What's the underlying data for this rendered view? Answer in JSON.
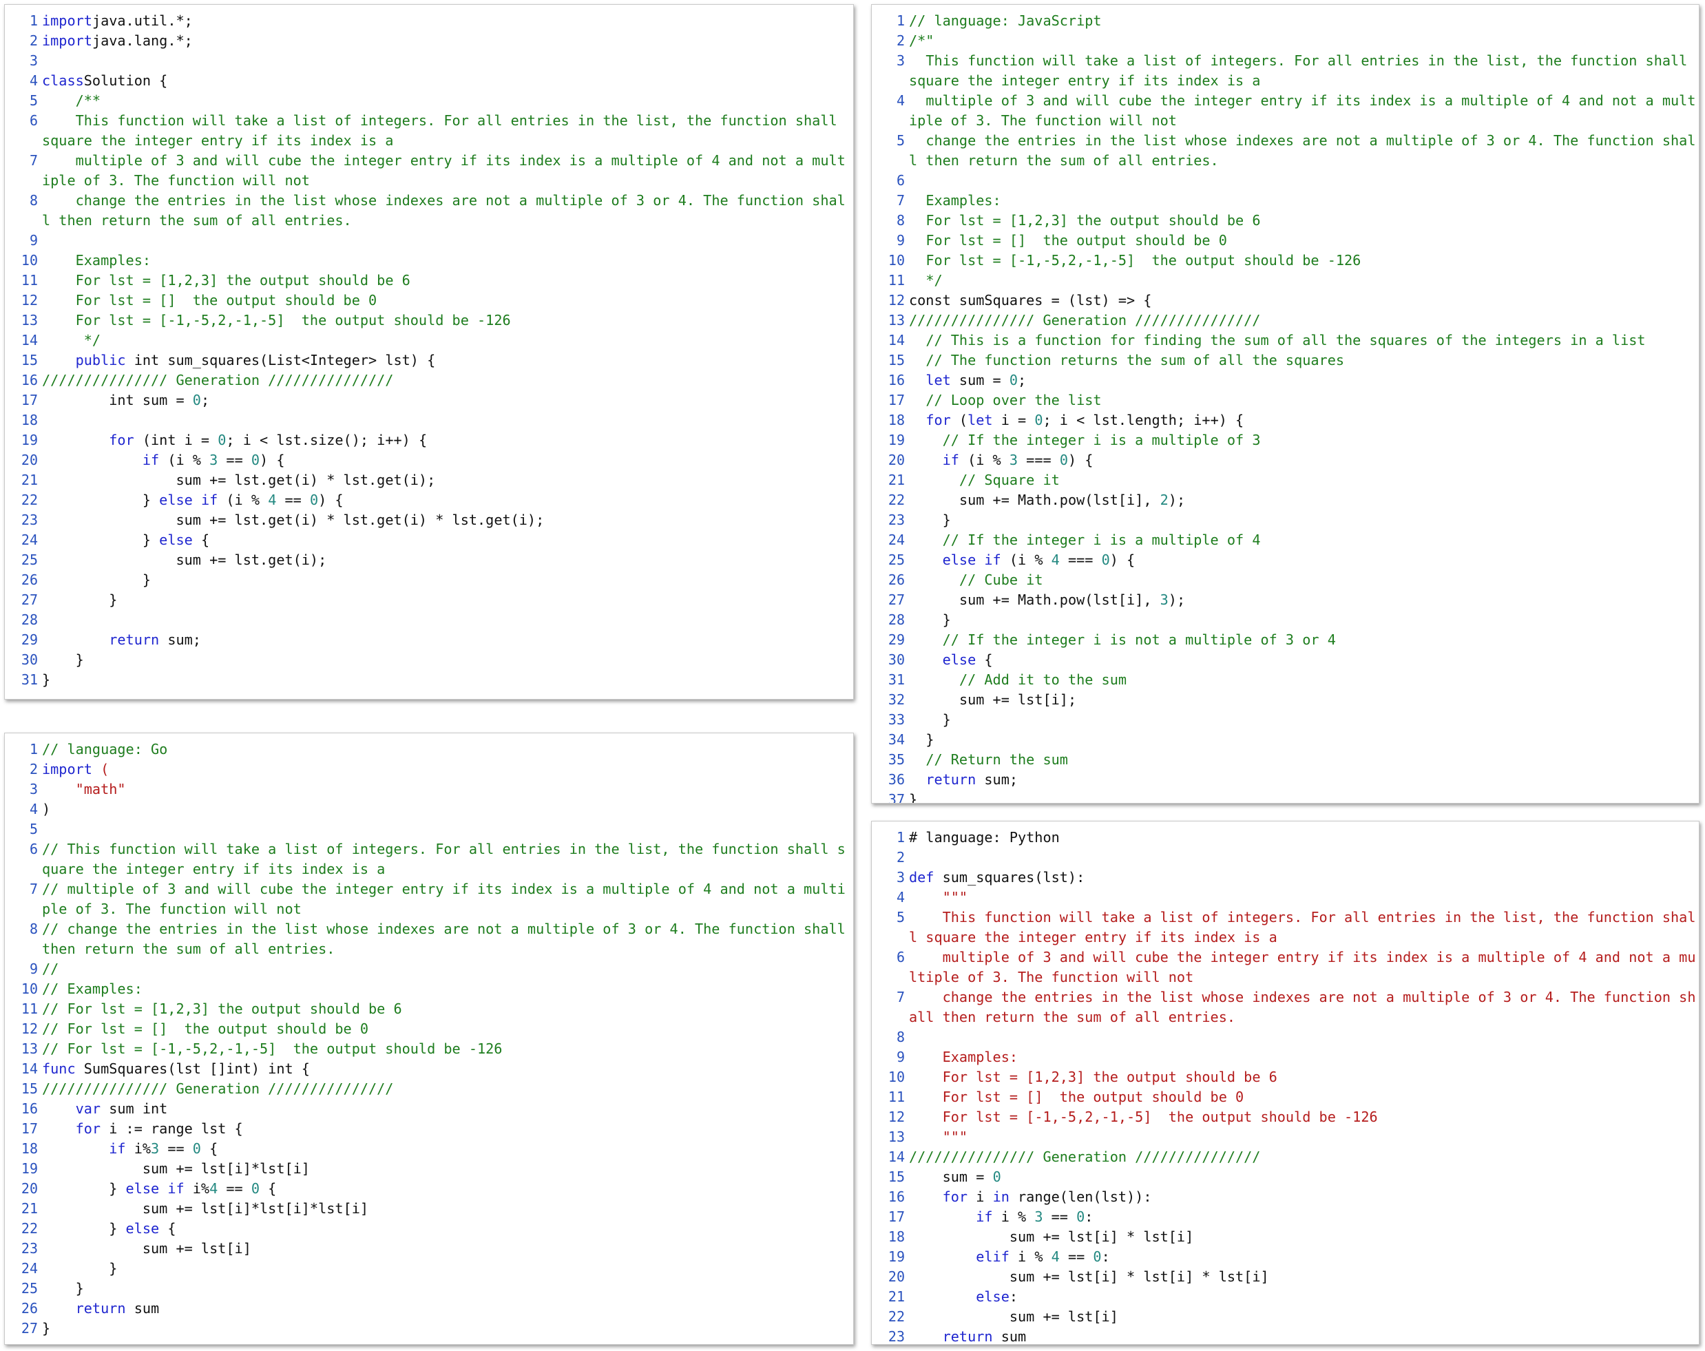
{
  "colors": {
    "keyword": "#1f26cf",
    "comment": "#1e7d1e",
    "number": "#228880",
    "string": "#b51d1d",
    "line_number": "#2a52be",
    "text": "#111111"
  },
  "panels": [
    {
      "id": "java",
      "lines": [
        [
          [
            "kw",
            "import"
          ],
          [
            "",
            "java.util.*;"
          ]
        ],
        [
          [
            "kw",
            "import"
          ],
          [
            "",
            "java.lang.*;"
          ]
        ],
        [],
        [
          [
            "kw",
            "class"
          ],
          [
            "",
            "Solution {"
          ]
        ],
        [
          [
            "com",
            "    /**"
          ]
        ],
        [
          [
            "com",
            "    This function will take a list of integers. For all entries in the list, the function shall square the integer entry if its index is a"
          ]
        ],
        [
          [
            "com",
            "    multiple of 3 and will cube the integer entry if its index is a multiple of 4 and not a multiple of 3. The function will not"
          ]
        ],
        [
          [
            "com",
            "    change the entries in the list whose indexes are not a multiple of 3 or 4. The function shall then return the sum of all entries."
          ]
        ],
        [],
        [
          [
            "com",
            "    Examples:"
          ]
        ],
        [
          [
            "com",
            "    For lst = [1,2,3] the output should be 6"
          ]
        ],
        [
          [
            "com",
            "    For lst = []  the output should be 0"
          ]
        ],
        [
          [
            "com",
            "    For lst = [-1,-5,2,-1,-5]  the output should be -126"
          ]
        ],
        [
          [
            "com",
            "     */"
          ]
        ],
        [
          [
            "",
            "    "
          ],
          [
            "kw",
            "public"
          ],
          [
            "",
            " int sum_squares(List<Integer> lst) {"
          ]
        ],
        [
          [
            "com",
            "/////////////// Generation ///////////////"
          ]
        ],
        [
          [
            "",
            "        int sum = "
          ],
          [
            "num",
            "0"
          ],
          [
            "",
            ";"
          ]
        ],
        [],
        [
          [
            "",
            "        "
          ],
          [
            "kw",
            "for"
          ],
          [
            "",
            " (int i = "
          ],
          [
            "num",
            "0"
          ],
          [
            "",
            "; i < lst.size(); i++) {"
          ]
        ],
        [
          [
            "",
            "            "
          ],
          [
            "kw",
            "if"
          ],
          [
            "",
            " (i % "
          ],
          [
            "num",
            "3"
          ],
          [
            "",
            " == "
          ],
          [
            "num",
            "0"
          ],
          [
            "",
            ") {"
          ]
        ],
        [
          [
            "",
            "                sum += lst.get(i) * lst.get(i);"
          ]
        ],
        [
          [
            "",
            "            } "
          ],
          [
            "kw",
            "else if"
          ],
          [
            "",
            " (i % "
          ],
          [
            "num",
            "4"
          ],
          [
            "",
            " == "
          ],
          [
            "num",
            "0"
          ],
          [
            "",
            ") {"
          ]
        ],
        [
          [
            "",
            "                sum += lst.get(i) * lst.get(i) * lst.get(i);"
          ]
        ],
        [
          [
            "",
            "            } "
          ],
          [
            "kw",
            "else"
          ],
          [
            "",
            " {"
          ]
        ],
        [
          [
            "",
            "                sum += lst.get(i);"
          ]
        ],
        [
          [
            "",
            "            }"
          ]
        ],
        [
          [
            "",
            "        }"
          ]
        ],
        [],
        [
          [
            "",
            "        "
          ],
          [
            "kw",
            "return"
          ],
          [
            "",
            " sum;"
          ]
        ],
        [
          [
            "",
            "    }"
          ]
        ],
        [
          [
            "",
            "}"
          ]
        ]
      ]
    },
    {
      "id": "js",
      "lines": [
        [
          [
            "com",
            "// language: JavaScript"
          ]
        ],
        [
          [
            "com",
            "/*\""
          ]
        ],
        [
          [
            "com",
            "  This function will take a list of integers. For all entries in the list, the function shall square the integer entry if its index is a"
          ]
        ],
        [
          [
            "com",
            "  multiple of 3 and will cube the integer entry if its index is a multiple of 4 and not a multiple of 3. The function will not"
          ]
        ],
        [
          [
            "com",
            "  change the entries in the list whose indexes are not a multiple of 3 or 4. The function shall then return the sum of all entries."
          ]
        ],
        [],
        [
          [
            "com",
            "  Examples:"
          ]
        ],
        [
          [
            "com",
            "  For lst = [1,2,3] the output should be 6"
          ]
        ],
        [
          [
            "com",
            "  For lst = []  the output should be 0"
          ]
        ],
        [
          [
            "com",
            "  For lst = [-1,-5,2,-1,-5]  the output should be -126"
          ]
        ],
        [
          [
            "com",
            "  */"
          ]
        ],
        [
          [
            "",
            "const sumSquares = (lst) => {"
          ]
        ],
        [
          [
            "com",
            "/////////////// Generation ///////////////"
          ]
        ],
        [
          [
            "com",
            "  // This is a function for finding the sum of all the squares of the integers in a list"
          ]
        ],
        [
          [
            "com",
            "  // The function returns the sum of all the squares"
          ]
        ],
        [
          [
            "",
            "  "
          ],
          [
            "kw",
            "let"
          ],
          [
            "",
            " sum = "
          ],
          [
            "num",
            "0"
          ],
          [
            "",
            ";"
          ]
        ],
        [
          [
            "com",
            "  // Loop over the list"
          ]
        ],
        [
          [
            "",
            "  "
          ],
          [
            "kw",
            "for"
          ],
          [
            "",
            " ("
          ],
          [
            "kw",
            "let"
          ],
          [
            "",
            " i = "
          ],
          [
            "num",
            "0"
          ],
          [
            "",
            "; i < lst.length; i++) {"
          ]
        ],
        [
          [
            "com",
            "    // If the integer i is a multiple of 3"
          ]
        ],
        [
          [
            "",
            "    "
          ],
          [
            "kw",
            "if"
          ],
          [
            "",
            " (i % "
          ],
          [
            "num",
            "3"
          ],
          [
            "",
            " === "
          ],
          [
            "num",
            "0"
          ],
          [
            "",
            ") {"
          ]
        ],
        [
          [
            "com",
            "      // Square it"
          ]
        ],
        [
          [
            "",
            "      sum += Math.pow(lst[i], "
          ],
          [
            "num",
            "2"
          ],
          [
            "",
            ");"
          ]
        ],
        [
          [
            "",
            "    }"
          ]
        ],
        [
          [
            "com",
            "    // If the integer i is a multiple of 4"
          ]
        ],
        [
          [
            "",
            "    "
          ],
          [
            "kw",
            "else if"
          ],
          [
            "",
            " (i % "
          ],
          [
            "num",
            "4"
          ],
          [
            "",
            " === "
          ],
          [
            "num",
            "0"
          ],
          [
            "",
            ") {"
          ]
        ],
        [
          [
            "com",
            "      // Cube it"
          ]
        ],
        [
          [
            "",
            "      sum += Math.pow(lst[i], "
          ],
          [
            "num",
            "3"
          ],
          [
            "",
            ");"
          ]
        ],
        [
          [
            "",
            "    }"
          ]
        ],
        [
          [
            "com",
            "    // If the integer i is not a multiple of 3 or 4"
          ]
        ],
        [
          [
            "",
            "    "
          ],
          [
            "kw",
            "else"
          ],
          [
            "",
            " {"
          ]
        ],
        [
          [
            "com",
            "      // Add it to the sum"
          ]
        ],
        [
          [
            "",
            "      sum += lst[i];"
          ]
        ],
        [
          [
            "",
            "    }"
          ]
        ],
        [
          [
            "",
            "  }"
          ]
        ],
        [
          [
            "com",
            "  // Return the sum"
          ]
        ],
        [
          [
            "",
            "  "
          ],
          [
            "kw",
            "return"
          ],
          [
            "",
            " sum;"
          ]
        ],
        [
          [
            "",
            "}"
          ]
        ]
      ]
    },
    {
      "id": "go",
      "lines": [
        [
          [
            "com",
            "// language: Go"
          ]
        ],
        [
          [
            "kw",
            "import"
          ],
          [
            "",
            " "
          ],
          [
            "str",
            "("
          ]
        ],
        [
          [
            "str",
            "    \"math\""
          ]
        ],
        [
          [
            "",
            ")"
          ]
        ],
        [],
        [
          [
            "com",
            "// This function will take a list of integers. For all entries in the list, the function shall square the integer entry if its index is a"
          ]
        ],
        [
          [
            "com",
            "// multiple of 3 and will cube the integer entry if its index is a multiple of 4 and not a multiple of 3. The function will not"
          ]
        ],
        [
          [
            "com",
            "// change the entries in the list whose indexes are not a multiple of 3 or 4. The function shall then return the sum of all entries."
          ]
        ],
        [
          [
            "com",
            "//"
          ]
        ],
        [
          [
            "com",
            "// Examples:"
          ]
        ],
        [
          [
            "com",
            "// For lst = [1,2,3] the output should be 6"
          ]
        ],
        [
          [
            "com",
            "// For lst = []  the output should be 0"
          ]
        ],
        [
          [
            "com",
            "// For lst = [-1,-5,2,-1,-5]  the output should be -126"
          ]
        ],
        [
          [
            "kw",
            "func"
          ],
          [
            "",
            " SumSquares(lst []int) int {"
          ]
        ],
        [
          [
            "com",
            "/////////////// Generation ///////////////"
          ]
        ],
        [
          [
            "",
            "    "
          ],
          [
            "kw",
            "var"
          ],
          [
            "",
            " sum int"
          ]
        ],
        [
          [
            "",
            "    "
          ],
          [
            "kw",
            "for"
          ],
          [
            "",
            " i := range lst {"
          ]
        ],
        [
          [
            "",
            "        "
          ],
          [
            "kw",
            "if"
          ],
          [
            "",
            " i%"
          ],
          [
            "num",
            "3"
          ],
          [
            "",
            " == "
          ],
          [
            "num",
            "0"
          ],
          [
            "",
            " {"
          ]
        ],
        [
          [
            "",
            "            sum += lst[i]*lst[i]"
          ]
        ],
        [
          [
            "",
            "        } "
          ],
          [
            "kw",
            "else if"
          ],
          [
            "",
            " i%"
          ],
          [
            "num",
            "4"
          ],
          [
            "",
            " == "
          ],
          [
            "num",
            "0"
          ],
          [
            "",
            " {"
          ]
        ],
        [
          [
            "",
            "            sum += lst[i]*lst[i]*lst[i]"
          ]
        ],
        [
          [
            "",
            "        } "
          ],
          [
            "kw",
            "else"
          ],
          [
            "",
            " {"
          ]
        ],
        [
          [
            "",
            "            sum += lst[i]"
          ]
        ],
        [
          [
            "",
            "        }"
          ]
        ],
        [
          [
            "",
            "    }"
          ]
        ],
        [
          [
            "",
            "    "
          ],
          [
            "kw",
            "return"
          ],
          [
            "",
            " sum"
          ]
        ],
        [
          [
            "",
            "}"
          ]
        ]
      ]
    },
    {
      "id": "py",
      "lines": [
        [
          [
            "",
            "# language: Python"
          ]
        ],
        [],
        [
          [
            "kw",
            "def"
          ],
          [
            "",
            " sum_squares(lst):"
          ]
        ],
        [
          [
            "str",
            "    \"\"\""
          ]
        ],
        [
          [
            "str",
            "    This function will take a list of integers. For all entries in the list, the function shall square the integer entry if its index is a"
          ]
        ],
        [
          [
            "str",
            "    multiple of 3 and will cube the integer entry if its index is a multiple of 4 and not a multiple of 3. The function will not"
          ]
        ],
        [
          [
            "str",
            "    change the entries in the list whose indexes are not a multiple of 3 or 4. The function shall then return the sum of all entries."
          ]
        ],
        [],
        [
          [
            "str",
            "    Examples:"
          ]
        ],
        [
          [
            "str",
            "    For lst = [1,2,3] the output should be 6"
          ]
        ],
        [
          [
            "str",
            "    For lst = []  the output should be 0"
          ]
        ],
        [
          [
            "str",
            "    For lst = [-1,-5,2,-1,-5]  the output should be -126"
          ]
        ],
        [
          [
            "str",
            "    \"\"\""
          ]
        ],
        [
          [
            "com",
            "/////////////// Generation ///////////////"
          ]
        ],
        [
          [
            "",
            "    sum = "
          ],
          [
            "num",
            "0"
          ]
        ],
        [
          [
            "",
            "    "
          ],
          [
            "kw",
            "for"
          ],
          [
            "",
            " i "
          ],
          [
            "kw",
            "in"
          ],
          [
            "",
            " range(len(lst)):"
          ]
        ],
        [
          [
            "",
            "        "
          ],
          [
            "kw",
            "if"
          ],
          [
            "",
            " i % "
          ],
          [
            "num",
            "3"
          ],
          [
            "",
            " == "
          ],
          [
            "num",
            "0"
          ],
          [
            "",
            ":"
          ]
        ],
        [
          [
            "",
            "            sum += lst[i] * lst[i]"
          ]
        ],
        [
          [
            "",
            "        "
          ],
          [
            "kw",
            "elif"
          ],
          [
            "",
            " i % "
          ],
          [
            "num",
            "4"
          ],
          [
            "",
            " == "
          ],
          [
            "num",
            "0"
          ],
          [
            "",
            ":"
          ]
        ],
        [
          [
            "",
            "            sum += lst[i] * lst[i] * lst[i]"
          ]
        ],
        [
          [
            "",
            "        "
          ],
          [
            "kw",
            "else"
          ],
          [
            "",
            ":"
          ]
        ],
        [
          [
            "",
            "            sum += lst[i]"
          ]
        ],
        [
          [
            "",
            "    "
          ],
          [
            "kw",
            "return"
          ],
          [
            "",
            " sum"
          ]
        ]
      ]
    }
  ]
}
